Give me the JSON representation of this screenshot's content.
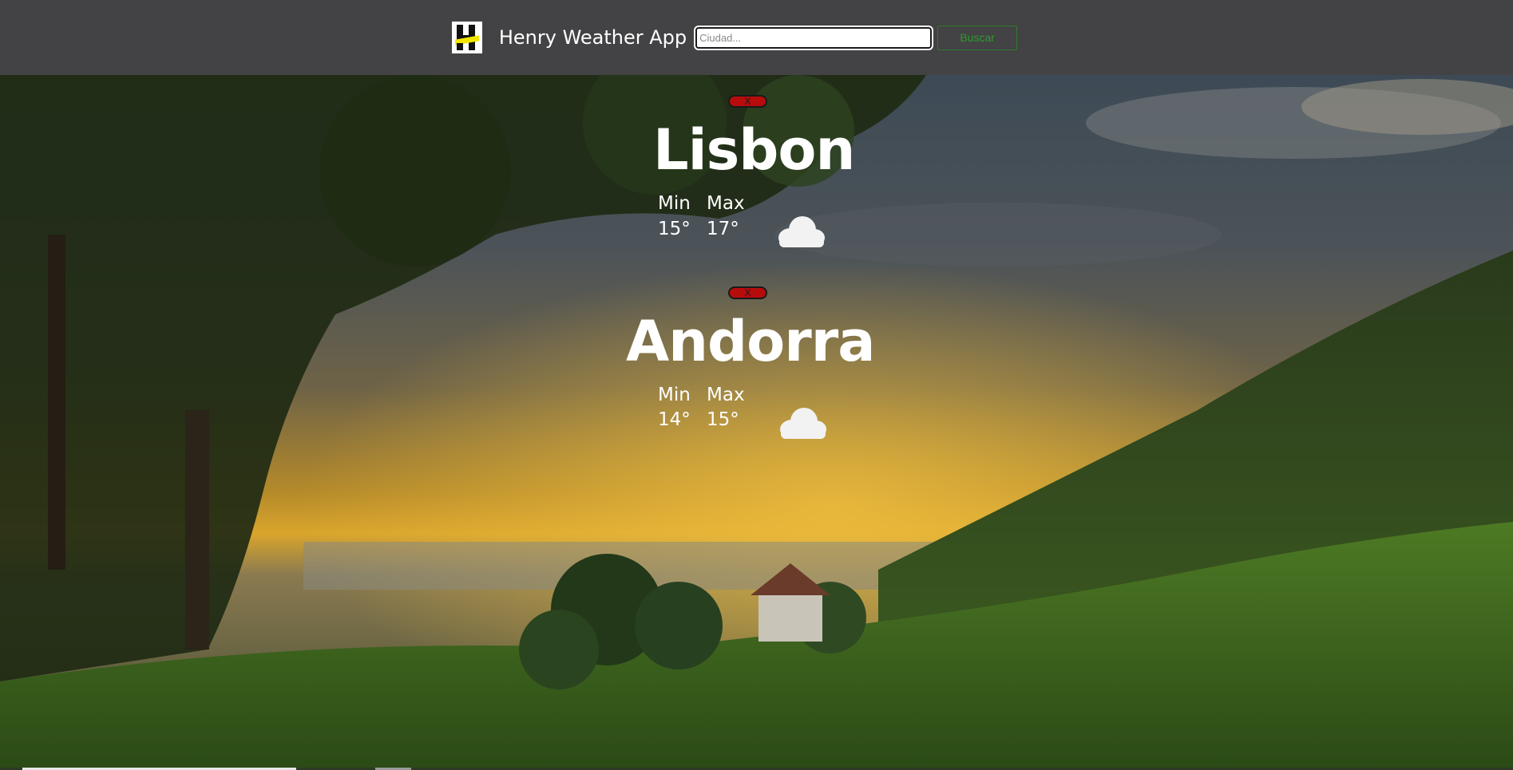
{
  "navbar": {
    "brand": "Henry Weather App",
    "search_placeholder": "Ciudad...",
    "search_value": "",
    "search_button": "Buscar"
  },
  "cities": [
    {
      "name": "Lisbon",
      "close_label": "X",
      "min_label": "Min",
      "max_label": "Max",
      "min": "15°",
      "max": "17°",
      "icon": "cloud-icon"
    },
    {
      "name": "Andorra",
      "close_label": "X",
      "min_label": "Min",
      "max_label": "Max",
      "min": "14°",
      "max": "15°",
      "icon": "cloud-icon"
    }
  ],
  "colors": {
    "navbar_bg": "#434244",
    "close_button": "#b70c0c",
    "search_button_border": "#2f7a2f",
    "logo_accent": "#f2e600"
  }
}
